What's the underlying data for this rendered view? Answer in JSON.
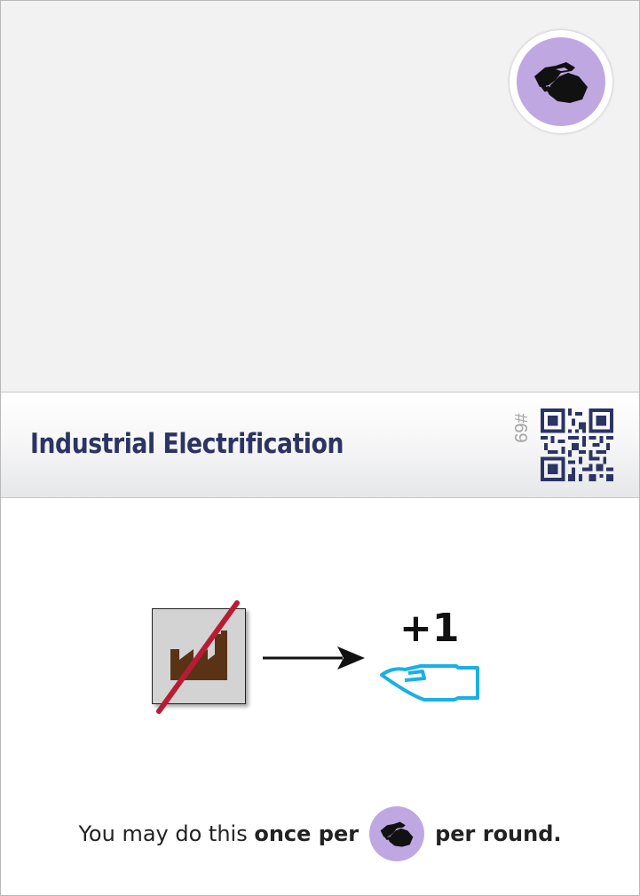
{
  "card": {
    "title": "Industrial Electrification",
    "number": "#69",
    "category_icon": "handshake-icon",
    "colors": {
      "title": "#2b3463",
      "badge": "#bfa8e2",
      "hand": "#1ab0e6",
      "slash": "#b81c34",
      "factory": "#5a3216"
    }
  },
  "effect": {
    "cost_icon": "factory-icon",
    "cost_modifier_icon": "slash-icon",
    "arrow_icon": "arrow-right-icon",
    "gain": "+1",
    "gain_icon": "hand-icon"
  },
  "rule": {
    "prefix": "You may do this ",
    "bold_1": "once per",
    "badge_icon": "handshake-icon",
    "bold_2": "per round."
  }
}
